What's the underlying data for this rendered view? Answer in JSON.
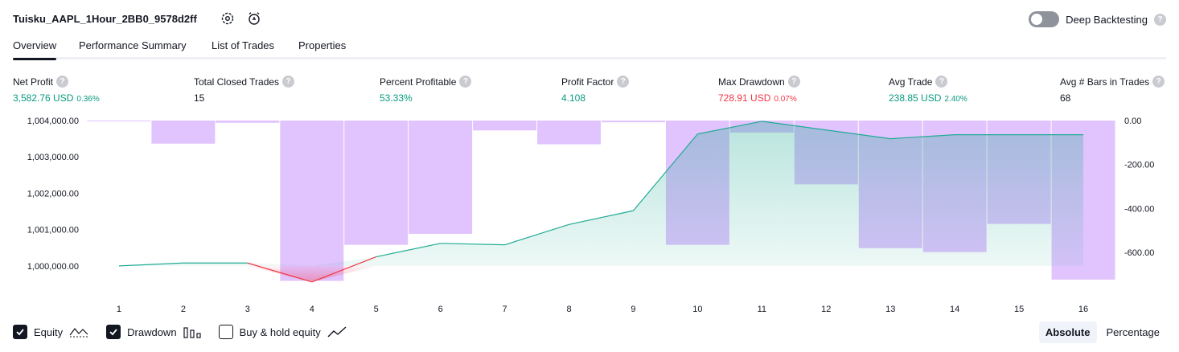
{
  "header": {
    "title": "Tuisku_AAPL_1Hour_2BB0_9578d2ff",
    "deep_backtesting_label": "Deep Backtesting",
    "deep_backtesting_on": false,
    "help_glyph": "?"
  },
  "tabs": [
    {
      "label": "Overview",
      "active": true
    },
    {
      "label": "Performance Summary",
      "active": false
    },
    {
      "label": "List of Trades",
      "active": false
    },
    {
      "label": "Properties",
      "active": false
    }
  ],
  "metrics": [
    {
      "label": "Net Profit",
      "value": "3,582.76 USD",
      "sub": "0.36%",
      "color": "green"
    },
    {
      "label": "Total Closed Trades",
      "value": "15",
      "sub": "",
      "color": "dark"
    },
    {
      "label": "Percent Profitable",
      "value": "53.33%",
      "sub": "",
      "color": "green"
    },
    {
      "label": "Profit Factor",
      "value": "4.108",
      "sub": "",
      "color": "green"
    },
    {
      "label": "Max Drawdown",
      "value": "728.91 USD",
      "sub": "0.07%",
      "color": "red"
    },
    {
      "label": "Avg Trade",
      "value": "238.85 USD",
      "sub": "2.40%",
      "color": "green"
    },
    {
      "label": "Avg # Bars in Trades",
      "value": "68",
      "sub": "",
      "color": "dark"
    }
  ],
  "chart_data": {
    "type": "line",
    "x": [
      1,
      2,
      3,
      4,
      5,
      6,
      7,
      8,
      9,
      10,
      11,
      12,
      13,
      14,
      15,
      16
    ],
    "series": [
      {
        "name": "Equity",
        "axis": "left",
        "values": [
          1000000,
          1000080,
          1000080,
          999560,
          1000250,
          1000620,
          1000580,
          1001140,
          1001520,
          1003630,
          1003980,
          1003740,
          1003500,
          1003610,
          1003610,
          1003610
        ]
      },
      {
        "name": "Drawdown",
        "axis": "right",
        "type": "bar",
        "values": [
          0,
          -105,
          -10,
          -728.91,
          -565,
          -515,
          -45,
          -108,
          -8,
          -565,
          -55,
          -290,
          -580,
          -598,
          -470,
          -723
        ]
      }
    ],
    "left_axis": {
      "ticks": [
        "1,004,000.00",
        "1,003,000.00",
        "1,002,000.00",
        "1,001,000.00",
        "1,000,000.00"
      ],
      "range": [
        999400,
        1004000
      ]
    },
    "right_axis": {
      "ticks": [
        "0.00",
        "-200.00",
        "-400.00",
        "-600.00"
      ],
      "range": [
        -760,
        0
      ]
    },
    "colors": {
      "equity": "#22ab94",
      "equity_below": "#f23645",
      "drawdown": "#e1c3fe"
    }
  },
  "legend": [
    {
      "label": "Equity",
      "checked": true,
      "icon": "equity-line-icon"
    },
    {
      "label": "Drawdown",
      "checked": true,
      "icon": "drawdown-bars-icon"
    },
    {
      "label": "Buy & hold equity",
      "checked": false,
      "icon": "buyhold-line-icon"
    }
  ],
  "view_mode": {
    "options": [
      "Absolute",
      "Percentage"
    ],
    "selected": "Absolute"
  }
}
